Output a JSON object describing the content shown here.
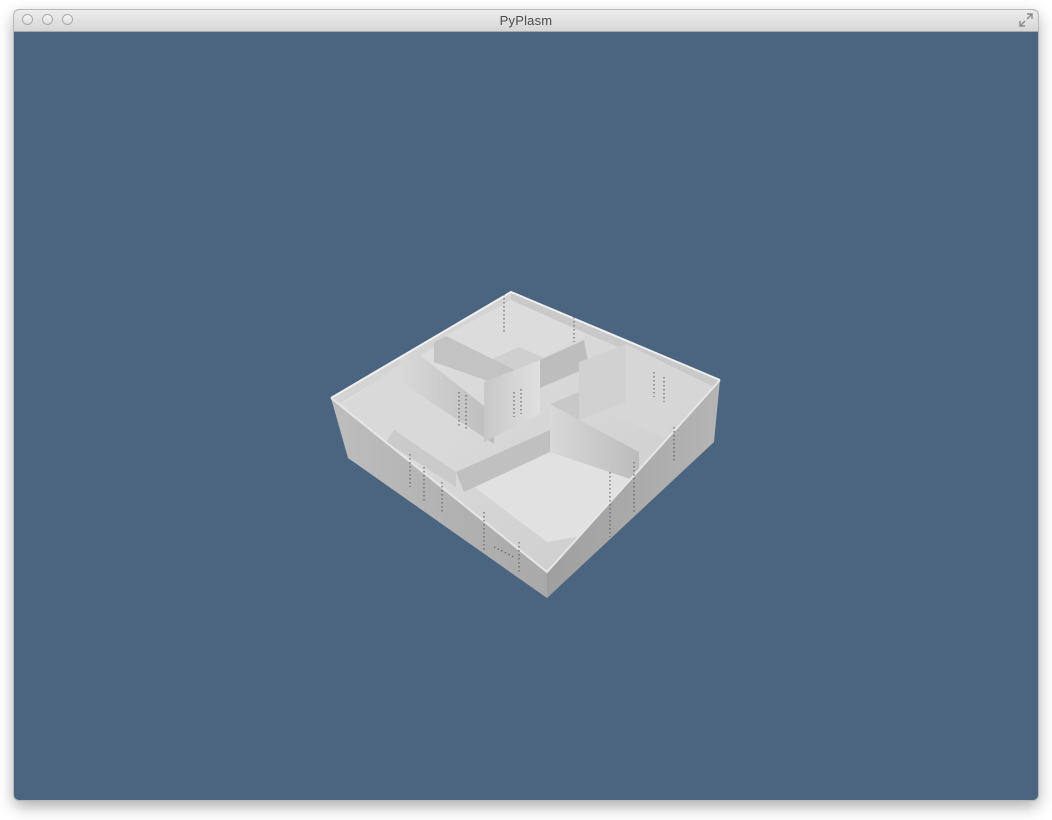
{
  "window": {
    "title": "PyPlasm"
  },
  "viewport": {
    "background_color": "#4b6480",
    "model_color": "#cfcfcf"
  },
  "icons": {
    "close": "close-button",
    "minimize": "minimize-button",
    "zoom": "zoom-button",
    "fullscreen": "fullscreen-arrows-icon"
  }
}
